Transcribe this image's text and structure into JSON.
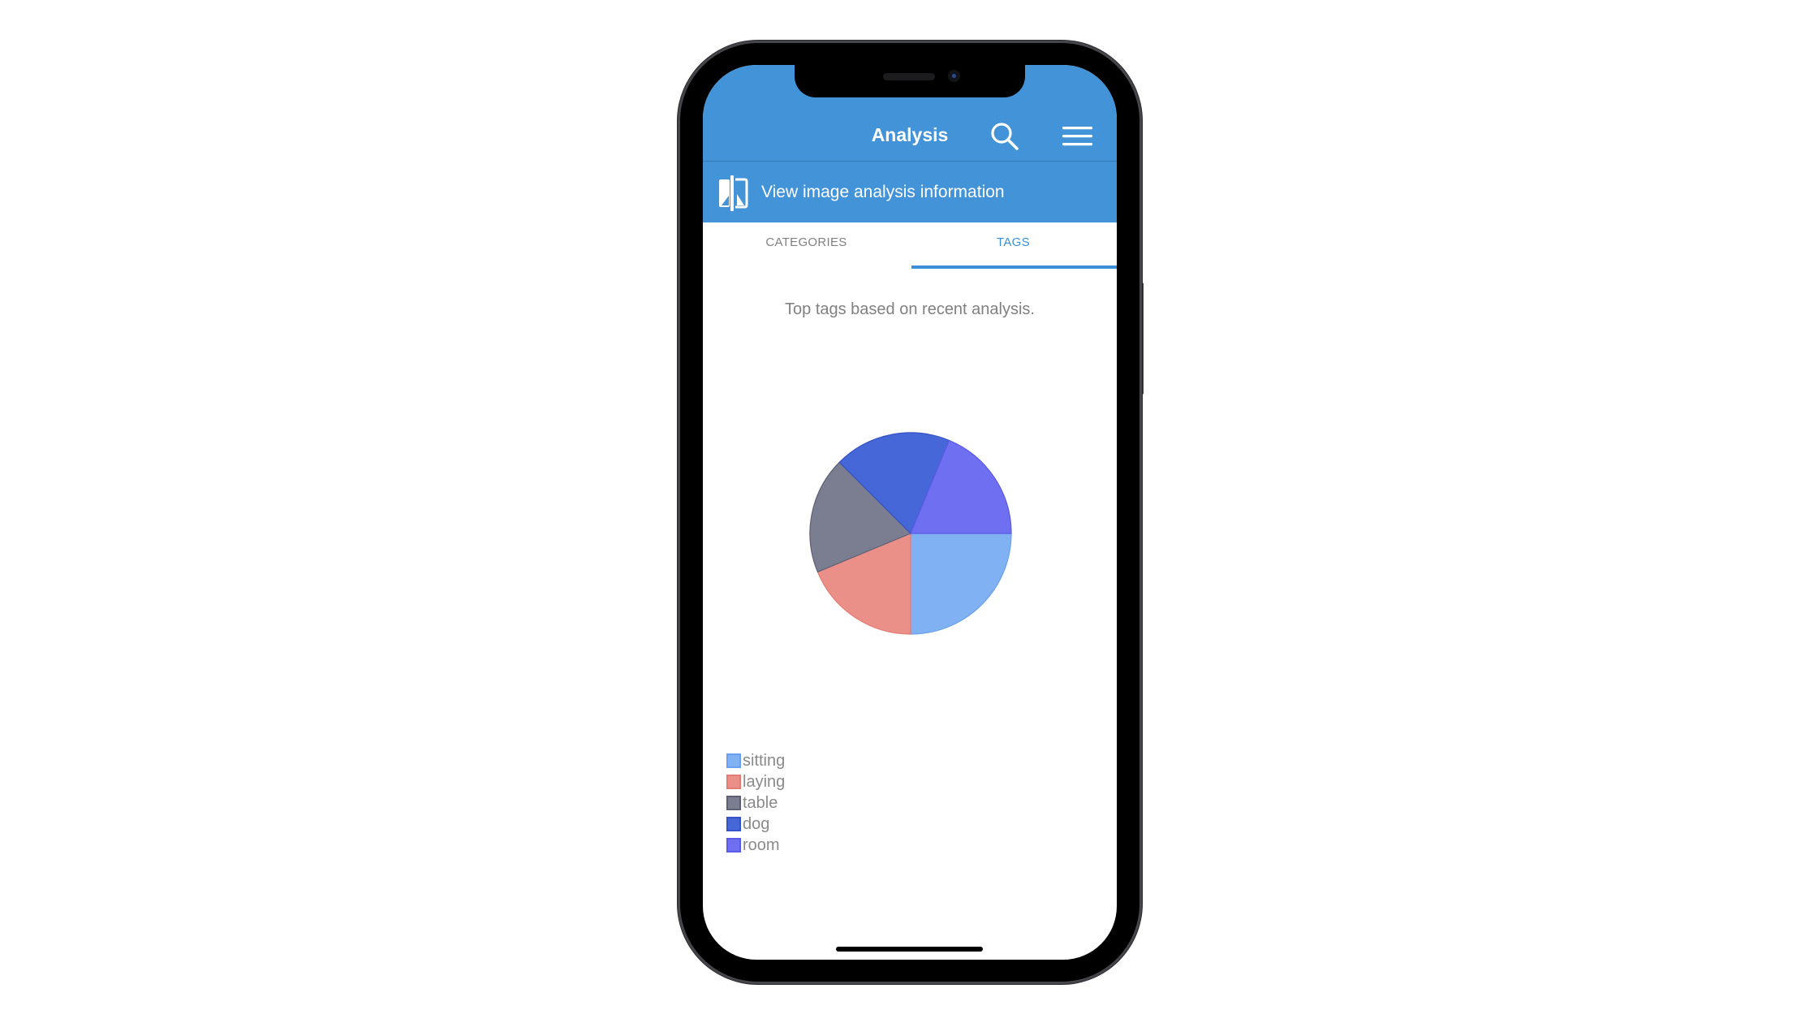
{
  "app": {
    "title": "Analysis",
    "icons": {
      "search": "search-icon",
      "menu": "hamburger-menu-icon",
      "banner": "image-compare-icon"
    }
  },
  "banner": {
    "label": "View image analysis information"
  },
  "tabs": [
    {
      "label": "CATEGORIES",
      "active": false
    },
    {
      "label": "TAGS",
      "active": true
    }
  ],
  "content": {
    "subtitle": "Top tags based on recent analysis."
  },
  "colors": {
    "primary": "#4293d8",
    "tab_active": "#3a8fd8"
  },
  "chart_data": {
    "type": "pie",
    "title": "",
    "start_angle_deg": 0,
    "direction": "clockwise",
    "legend_position": "bottom-left",
    "series": [
      {
        "name": "sitting",
        "value": 4,
        "percent": 25,
        "color": "#7fb1f3",
        "stroke": "#6aa0ee"
      },
      {
        "name": "laying",
        "value": 3,
        "percent": 18.75,
        "color": "#eb9088",
        "stroke": "#e47c74"
      },
      {
        "name": "table",
        "value": 3,
        "percent": 18.75,
        "color": "#7b7d90",
        "stroke": "#5d5f74"
      },
      {
        "name": "dog",
        "value": 3,
        "percent": 18.75,
        "color": "#4667d7",
        "stroke": "#3652c8"
      },
      {
        "name": "room",
        "value": 3,
        "percent": 18.75,
        "color": "#6f6ff1",
        "stroke": "#5a5ae6"
      }
    ]
  }
}
